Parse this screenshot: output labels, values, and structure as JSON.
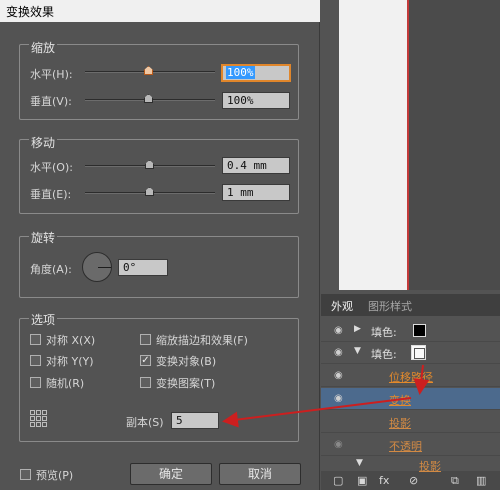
{
  "dialog": {
    "title": "变换效果",
    "scale": {
      "title": "缩放",
      "horizontal_label": "水平(H):",
      "horizontal_value": "100%",
      "vertical_label": "垂直(V):",
      "vertical_value": "100%"
    },
    "move": {
      "title": "移动",
      "horizontal_label": "水平(O):",
      "horizontal_value": "0.4 mm",
      "vertical_label": "垂直(E):",
      "vertical_value": "1 mm"
    },
    "rotate": {
      "title": "旋转",
      "angle_label": "角度(A):",
      "angle_value": "0°"
    },
    "options": {
      "title": "选项",
      "reflect_x": "对称 X(X)",
      "reflect_y": "对称 Y(Y)",
      "random": "随机(R)",
      "scale_strokes": "缩放描边和效果(F)",
      "transform_objects": "变换对象(B)",
      "transform_patterns": "变换图案(T)",
      "transform_objects_checked": true
    },
    "copies_label": "副本(S)",
    "copies_value": "5",
    "preview_label": "预览(P)",
    "ok_label": "确定",
    "cancel_label": "取消"
  },
  "appearance_panel": {
    "tabs": [
      "外观",
      "图形样式"
    ],
    "rows": [
      {
        "label": "填色:",
        "swatch": "black"
      },
      {
        "label": "填色:",
        "swatch": "white"
      },
      {
        "effect": "位移路径"
      },
      {
        "effect": "变换",
        "selected": true
      },
      {
        "effect": "投影"
      },
      {
        "effect": "不透明"
      },
      {
        "effect": "投影"
      }
    ]
  },
  "colors": {
    "annotation_arrow": "#cc1f1f",
    "focus_border": "#e0862b",
    "effect_link": "#e38a2c"
  }
}
